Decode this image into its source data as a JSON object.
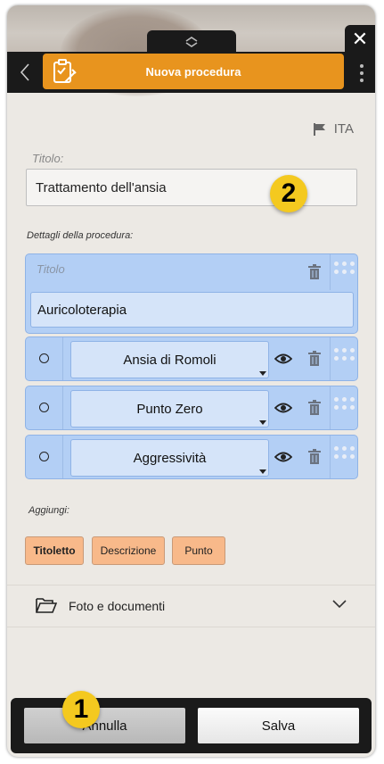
{
  "header": {
    "title": "Nuova procedura",
    "close_glyph": "✕",
    "back_glyph": "‹"
  },
  "language": {
    "code": "ITA",
    "icon": "flag-icon"
  },
  "form": {
    "title_label": "Titolo:",
    "title_value": "Trattamento dell'ansia",
    "details_label": "Dettagli della procedura:",
    "title_block": {
      "label": "Titolo",
      "value": "Auricoloterapia"
    },
    "points": [
      {
        "value": "Ansia di Romoli"
      },
      {
        "value": "Punto Zero"
      },
      {
        "value": "Aggressività"
      }
    ],
    "add_label": "Aggiungi:",
    "add_buttons": [
      "Titoletto",
      "Descrizione",
      "Punto"
    ],
    "attachments_label": "Foto e documenti"
  },
  "badges": {
    "first": "1",
    "second": "2"
  },
  "footer": {
    "cancel_label": "Annulla",
    "save_label": "Salva"
  },
  "colors": {
    "accent": "#e8941e",
    "block": "#b3cff5",
    "chip": "#f8b98a",
    "badge": "#f4c91f"
  }
}
